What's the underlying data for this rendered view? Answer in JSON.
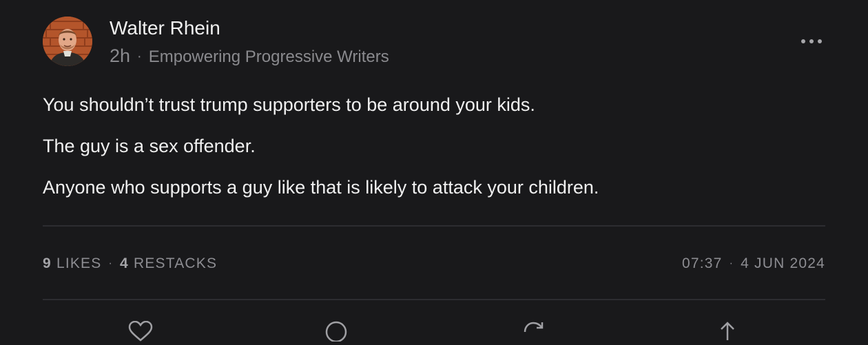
{
  "post": {
    "author": "Walter Rhein",
    "age": "2h",
    "separator": "·",
    "publication": "Empowering Progressive Writers",
    "paragraphs": [
      "You shouldn’t trust trump supporters to be around your kids.",
      "The guy is a sex offender.",
      "Anyone who supports a guy like that is likely to attack your children."
    ]
  },
  "stats": {
    "likes_count": "9",
    "likes_label": "LIKES",
    "restacks_count": "4",
    "restacks_label": "RESTACKS",
    "time": "07:37",
    "date": "4 JUN 2024",
    "separator": "·"
  },
  "actions": [
    "heart-icon",
    "comment-icon",
    "restack-icon",
    "share-icon"
  ],
  "colors": {
    "background": "#19191b",
    "text": "#f0f0f0",
    "muted": "#8a8a8e",
    "divider": "#2d2d31"
  }
}
